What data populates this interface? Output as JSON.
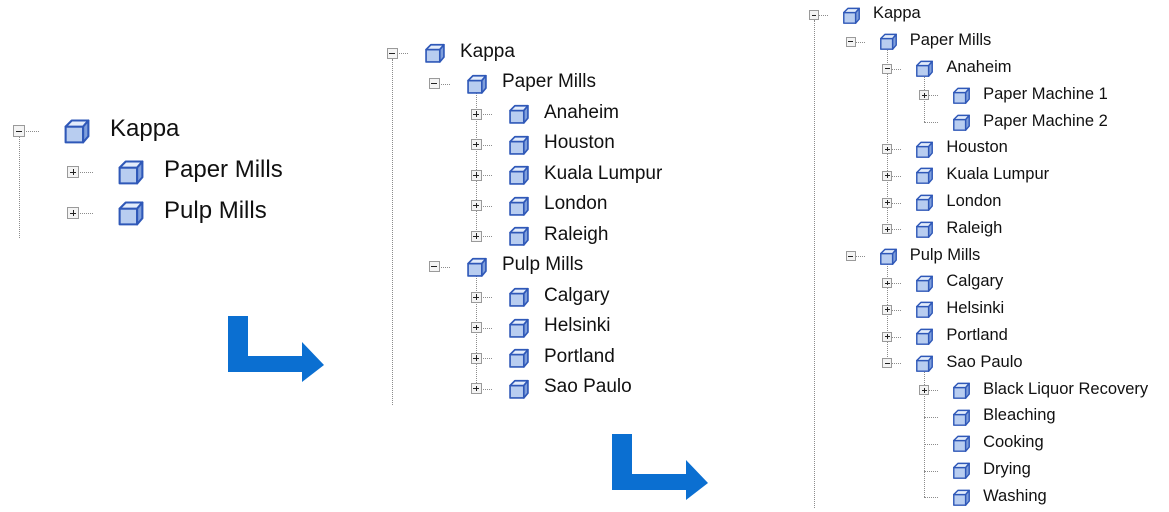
{
  "colors": {
    "icon_fill": "#b8cdf0",
    "icon_stroke": "#2f58b8",
    "arrow": "#0b6fd1"
  },
  "tree1": [
    {
      "label": "Kappa",
      "level": 0,
      "toggle": "minus"
    },
    {
      "label": "Paper Mills",
      "level": 1,
      "toggle": "plus"
    },
    {
      "label": "Pulp Mills",
      "level": 1,
      "toggle": "plus"
    }
  ],
  "tree2": [
    {
      "label": "Kappa",
      "level": 0,
      "toggle": "minus"
    },
    {
      "label": "Paper Mills",
      "level": 1,
      "toggle": "minus"
    },
    {
      "label": "Anaheim",
      "level": 2,
      "toggle": "plus"
    },
    {
      "label": "Houston",
      "level": 2,
      "toggle": "plus"
    },
    {
      "label": "Kuala Lumpur",
      "level": 2,
      "toggle": "plus"
    },
    {
      "label": "London",
      "level": 2,
      "toggle": "plus"
    },
    {
      "label": "Raleigh",
      "level": 2,
      "toggle": "plus"
    },
    {
      "label": "Pulp Mills",
      "level": 1,
      "toggle": "minus"
    },
    {
      "label": "Calgary",
      "level": 2,
      "toggle": "plus"
    },
    {
      "label": "Helsinki",
      "level": 2,
      "toggle": "plus"
    },
    {
      "label": "Portland",
      "level": 2,
      "toggle": "plus"
    },
    {
      "label": "Sao Paulo",
      "level": 2,
      "toggle": "plus"
    }
  ],
  "tree3": [
    {
      "label": "Kappa",
      "level": 0,
      "toggle": "minus"
    },
    {
      "label": "Paper Mills",
      "level": 1,
      "toggle": "minus"
    },
    {
      "label": "Anaheim",
      "level": 2,
      "toggle": "minus"
    },
    {
      "label": "Paper Machine 1",
      "level": 3,
      "toggle": "plus"
    },
    {
      "label": "Paper Machine 2",
      "level": 3,
      "toggle": "none"
    },
    {
      "label": "Houston",
      "level": 2,
      "toggle": "plus"
    },
    {
      "label": "Kuala Lumpur",
      "level": 2,
      "toggle": "plus"
    },
    {
      "label": "London",
      "level": 2,
      "toggle": "plus"
    },
    {
      "label": "Raleigh",
      "level": 2,
      "toggle": "plus"
    },
    {
      "label": "Pulp Mills",
      "level": 1,
      "toggle": "minus"
    },
    {
      "label": "Calgary",
      "level": 2,
      "toggle": "plus"
    },
    {
      "label": "Helsinki",
      "level": 2,
      "toggle": "plus"
    },
    {
      "label": "Portland",
      "level": 2,
      "toggle": "plus"
    },
    {
      "label": "Sao Paulo",
      "level": 2,
      "toggle": "minus"
    },
    {
      "label": "Black Liquor Recovery",
      "level": 3,
      "toggle": "plus"
    },
    {
      "label": "Bleaching",
      "level": 3,
      "toggle": "none"
    },
    {
      "label": "Cooking",
      "level": 3,
      "toggle": "none"
    },
    {
      "label": "Drying",
      "level": 3,
      "toggle": "none"
    },
    {
      "label": "Washing",
      "level": 3,
      "toggle": "none"
    }
  ]
}
